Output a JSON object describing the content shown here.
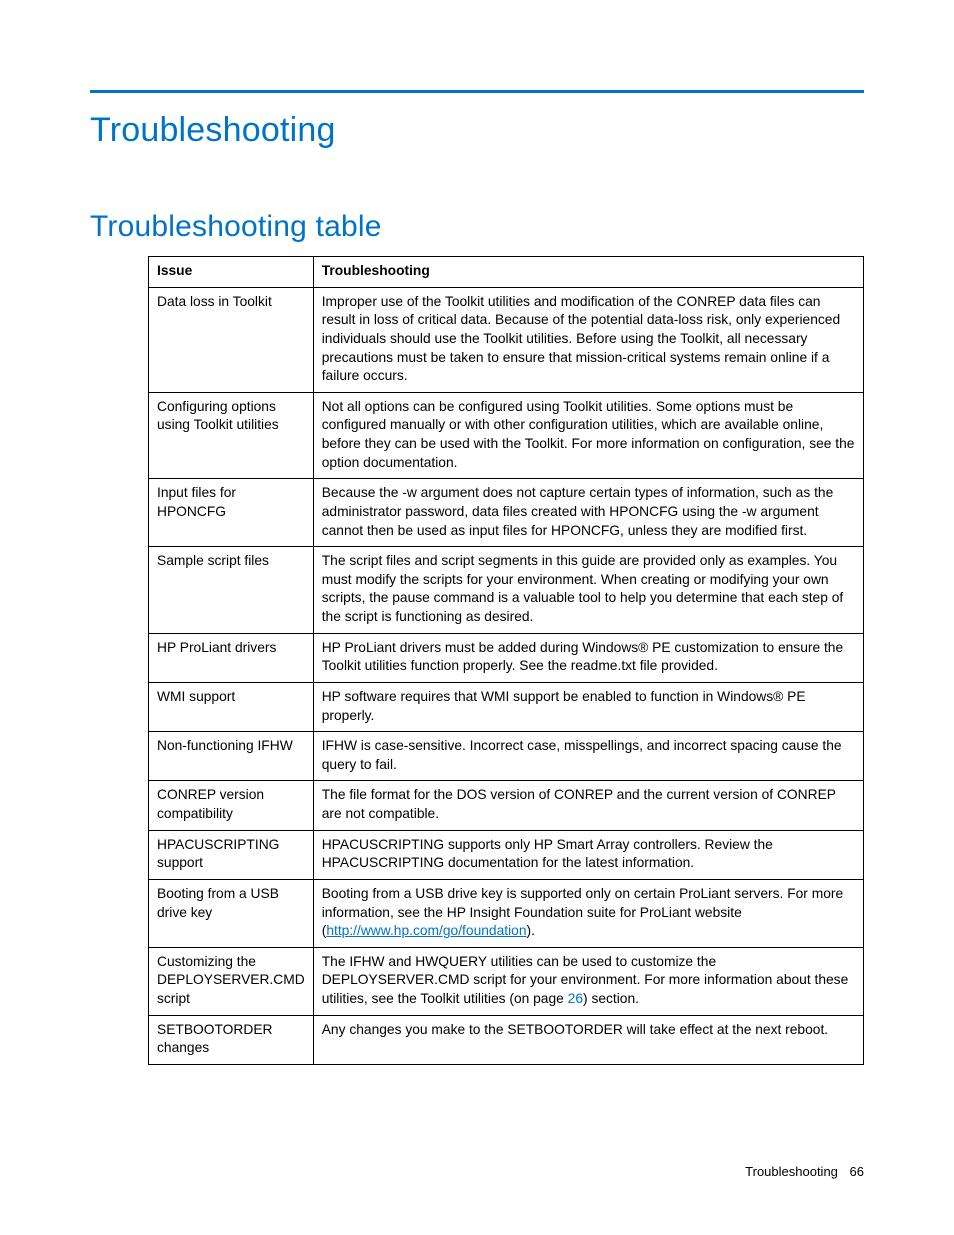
{
  "chapter_title": "Troubleshooting",
  "section_title": "Troubleshooting table",
  "table": {
    "headers": {
      "issue": "Issue",
      "trouble": "Troubleshooting"
    },
    "rows": [
      {
        "issue": "Data loss in Toolkit",
        "trouble": "Improper use of the Toolkit utilities and modification of the CONREP data files can result in loss of critical data. Because of the potential data-loss risk, only experienced individuals should use the Toolkit utilities. Before using the Toolkit, all necessary precautions must be taken to ensure that mission-critical systems remain online if a failure occurs."
      },
      {
        "issue": "Configuring options using Toolkit utilities",
        "trouble": "Not all options can be configured using Toolkit utilities. Some options must be configured manually or with other configuration utilities, which are available online, before they can be used with the Toolkit. For more information on configuration, see the option documentation."
      },
      {
        "issue": "Input files for HPONCFG",
        "trouble": "Because the -w argument does not capture certain types of information, such as the administrator password, data files created with HPONCFG using the -w argument cannot then be used as input files for HPONCFG, unless they are modified first."
      },
      {
        "issue": "Sample script files",
        "trouble": "The script files and script segments in this guide are provided only as examples. You must modify the scripts for your environment. When creating or modifying your own scripts, the pause command is a valuable tool to help you determine that each step of the script is functioning as desired."
      },
      {
        "issue": "HP ProLiant drivers",
        "trouble": "HP ProLiant drivers must be added during Windows® PE customization to ensure the Toolkit utilities function properly. See the readme.txt file provided."
      },
      {
        "issue": "WMI support",
        "trouble": "HP software requires that WMI support be enabled to function in Windows® PE properly."
      },
      {
        "issue": "Non-functioning IFHW",
        "trouble": "IFHW is case-sensitive. Incorrect case, misspellings, and incorrect spacing cause the query to fail."
      },
      {
        "issue": "CONREP version compatibility",
        "trouble": "The file format for the DOS version of CONREP and the current version of CONREP are not compatible."
      },
      {
        "issue": "HPACUSCRIPTING support",
        "trouble": "HPACUSCRIPTING supports only HP Smart Array controllers. Review the HPACUSCRIPTING documentation for the latest information."
      },
      {
        "issue": "Booting from a USB drive key",
        "trouble_pre": "Booting from a USB drive key is supported only on certain ProLiant servers. For more information, see the HP Insight Foundation suite for ProLiant website (",
        "link": "http://www.hp.com/go/foundation",
        "trouble_post": ")."
      },
      {
        "issue": "Customizing the DEPLOYSERVER.CMD script",
        "trouble_pre": "The IFHW and HWQUERY utilities can be used to customize the DEPLOYSERVER.CMD script for your environment. For more information about these utilities, see the Toolkit utilities (on page ",
        "pageref": "26",
        "trouble_post": ") section."
      },
      {
        "issue": "SETBOOTORDER changes",
        "trouble": "Any changes you make to the SETBOOTORDER will take effect at the next reboot."
      }
    ]
  },
  "footer": {
    "label": "Troubleshooting",
    "page": "66"
  }
}
